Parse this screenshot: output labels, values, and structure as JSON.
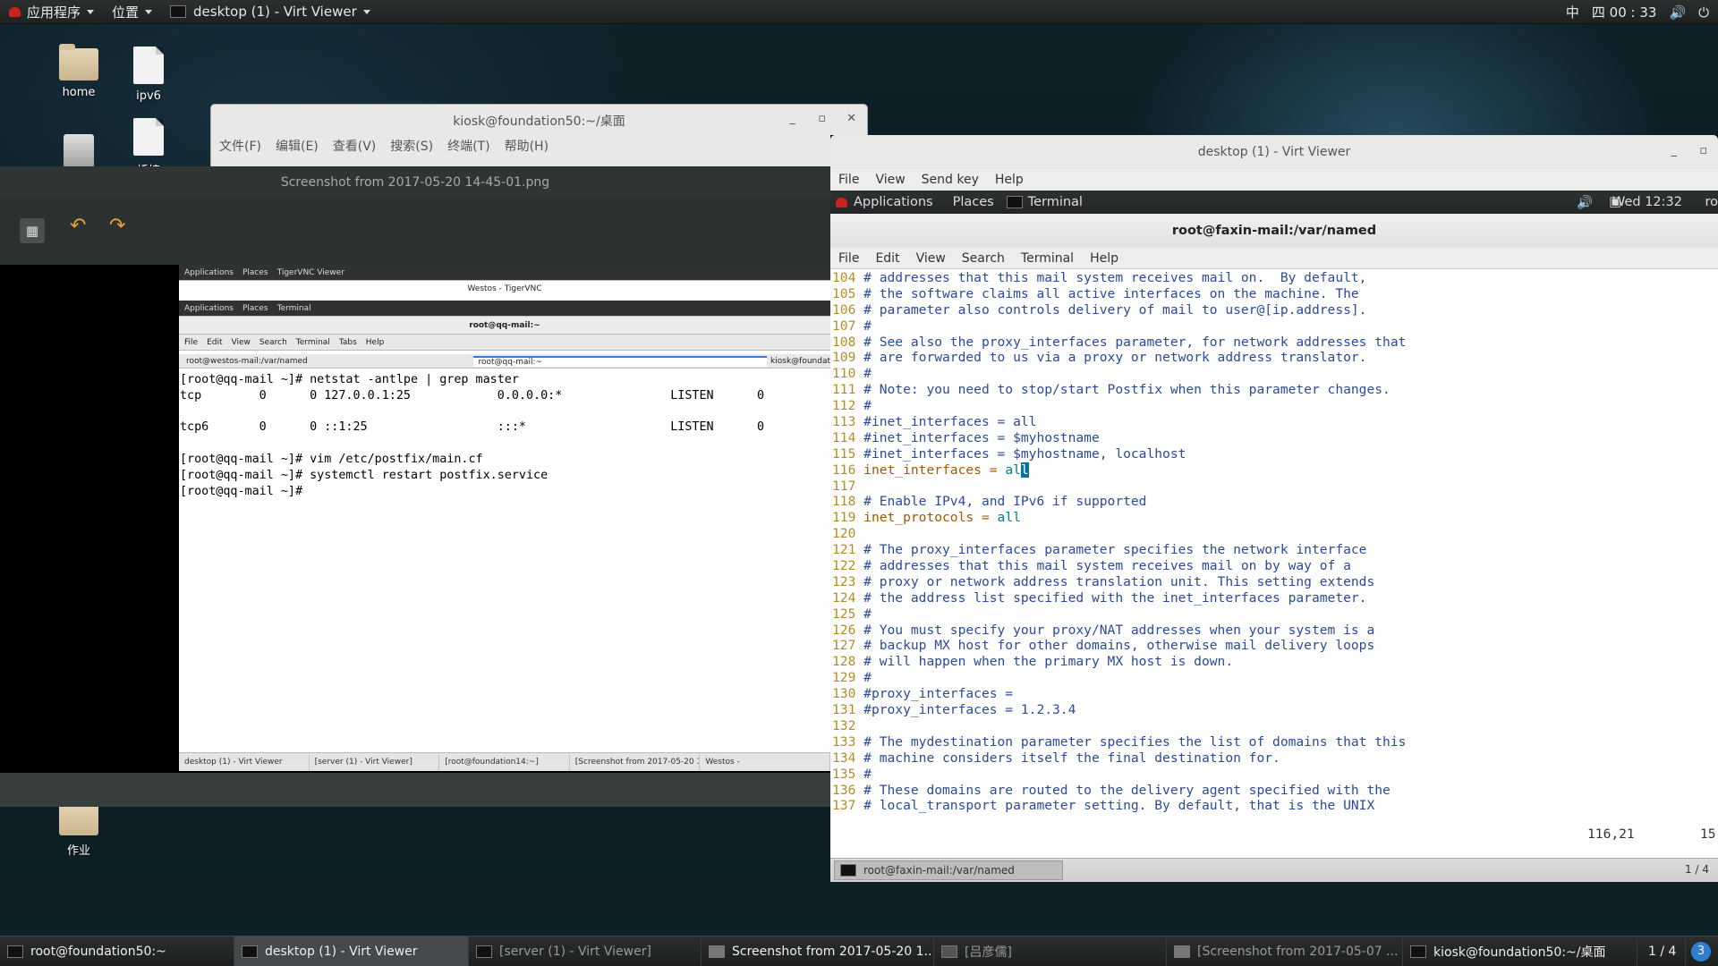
{
  "topbar": {
    "apps": "应用程序",
    "places": "位置",
    "window": "desktop (1) - Virt Viewer",
    "ime": "中",
    "clock": "四 00 : 33"
  },
  "desktop": {
    "icons": [
      "home",
      "ipv6",
      "作业"
    ],
    "partial_label": "插接"
  },
  "kiosk_window": {
    "title": "kiosk@foundation50:~/桌面",
    "menu": [
      "文件(F)",
      "编辑(E)",
      "查看(V)",
      "搜索(S)",
      "终端(T)",
      "帮助(H)"
    ]
  },
  "viewer": {
    "title": "Screenshot from 2017-05-20 14-45-01.png"
  },
  "inner": {
    "topbar": {
      "apps": "Applications",
      "places": "Places",
      "window": "TigerVNC Viewer"
    },
    "vnc_title": "Westos - TigerVNC",
    "guestbar": {
      "apps": "Applications",
      "places": "Places",
      "window": "Terminal"
    },
    "term_title": "root@qq-mail:~",
    "menu": [
      "File",
      "Edit",
      "View",
      "Search",
      "Terminal",
      "Tabs",
      "Help"
    ],
    "tabs": [
      "root@westos-mail:/var/named",
      "root@qq-mail:~",
      "kiosk@foundat"
    ],
    "lines": [
      "[root@qq-mail ~]# netstat -antlpe | grep master",
      "tcp        0      0 127.0.0.1:25            0.0.0.0:*               LISTEN      0",
      "",
      "tcp6       0      0 ::1:25                  :::*                    LISTEN      0",
      "",
      "[root@qq-mail ~]# vim /etc/postfix/main.cf",
      "[root@qq-mail ~]# systemctl restart postfix.service",
      "[root@qq-mail ~]#"
    ],
    "taskbar": [
      "desktop (1) - Virt Viewer",
      "[server (1) - Virt Viewer]",
      "[root@foundation14:~]",
      "[Screenshot from 2017-05-20 1...",
      "Westos -"
    ]
  },
  "virt": {
    "title": "desktop (1) - Virt Viewer",
    "menu": [
      "File",
      "View",
      "Send key",
      "Help"
    ],
    "guestbar": {
      "apps": "Applications",
      "places": "Places",
      "window": "Terminal",
      "clock": "Wed 12:32",
      "user": "ro"
    },
    "term_title": "root@faxin-mail:/var/named",
    "term_menu": [
      "File",
      "Edit",
      "View",
      "Search",
      "Terminal",
      "Help"
    ],
    "code": [
      [
        "104",
        "# addresses that this mail system receives mail on.  By default,"
      ],
      [
        "105",
        "# the software claims all active interfaces on the machine. The"
      ],
      [
        "106",
        "# parameter also controls delivery of mail to user@[ip.address]."
      ],
      [
        "107",
        "#"
      ],
      [
        "108",
        "# See also the proxy_interfaces parameter, for network addresses that"
      ],
      [
        "109",
        "# are forwarded to us via a proxy or network address translator."
      ],
      [
        "110",
        "#"
      ],
      [
        "111",
        "# Note: you need to stop/start Postfix when this parameter changes."
      ],
      [
        "112",
        "#"
      ],
      [
        "113",
        "#inet_interfaces = all"
      ],
      [
        "114",
        "#inet_interfaces = $myhostname"
      ],
      [
        "115",
        "#inet_interfaces = $myhostname, localhost"
      ],
      [
        "116",
        "inet_interfaces = all"
      ],
      [
        "117",
        ""
      ],
      [
        "118",
        "# Enable IPv4, and IPv6 if supported"
      ],
      [
        "119",
        "inet_protocols = all"
      ],
      [
        "120",
        ""
      ],
      [
        "121",
        "# The proxy_interfaces parameter specifies the network interface"
      ],
      [
        "122",
        "# addresses that this mail system receives mail on by way of a"
      ],
      [
        "123",
        "# proxy or network address translation unit. This setting extends"
      ],
      [
        "124",
        "# the address list specified with the inet_interfaces parameter."
      ],
      [
        "125",
        "#"
      ],
      [
        "126",
        "# You must specify your proxy/NAT addresses when your system is a"
      ],
      [
        "127",
        "# backup MX host for other domains, otherwise mail delivery loops"
      ],
      [
        "128",
        "# will happen when the primary MX host is down."
      ],
      [
        "129",
        "#"
      ],
      [
        "130",
        "#proxy_interfaces ="
      ],
      [
        "131",
        "#proxy_interfaces = 1.2.3.4"
      ],
      [
        "132",
        ""
      ],
      [
        "133",
        "# The mydestination parameter specifies the list of domains that this"
      ],
      [
        "134",
        "# machine considers itself the final destination for."
      ],
      [
        "135",
        "#"
      ],
      [
        "136",
        "# These domains are routed to the delivery agent specified with the"
      ],
      [
        "137",
        "# local_transport parameter setting. By default, that is the UNIX"
      ]
    ],
    "status_pos": "116,21",
    "status_pct": "15",
    "gtask": "root@faxin-mail:/var/named",
    "gpager": "1 / 4"
  },
  "taskbar": {
    "items": [
      "root@foundation50:~",
      "desktop (1) - Virt Viewer",
      "[server (1) - Virt Viewer]",
      "Screenshot from 2017-05-20 1...",
      "[吕彦儒]",
      "[Screenshot from 2017-05-07 ...",
      "kiosk@foundation50:~/桌面"
    ],
    "pager": "1 / 4",
    "badge": "3"
  }
}
